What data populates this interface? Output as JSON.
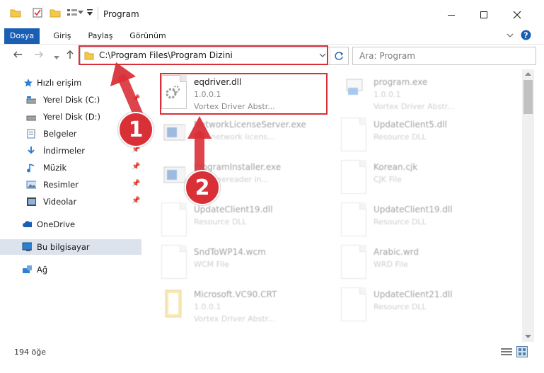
{
  "window": {
    "title": "Program"
  },
  "ribbon": {
    "tabs": [
      {
        "label": "Dosya",
        "active": true
      },
      {
        "label": "Giriş"
      },
      {
        "label": "Paylaş"
      },
      {
        "label": "Görünüm"
      }
    ]
  },
  "address": {
    "path": "C:\\Program Files\\Program Dizini"
  },
  "search": {
    "placeholder": "Ara: Program"
  },
  "nav": {
    "items": [
      {
        "label": "Hızlı erişim",
        "icon": "star-icon"
      },
      {
        "label": "Yerel Disk (C:)",
        "icon": "drive-icon",
        "pinned": true
      },
      {
        "label": "Yerel Disk (D:)",
        "icon": "drive-icon"
      },
      {
        "label": "Belgeler",
        "icon": "documents-icon"
      },
      {
        "label": "İndirmeler",
        "icon": "download-icon",
        "pinned": true
      },
      {
        "label": "Müzik",
        "icon": "music-icon",
        "pinned": true
      },
      {
        "label": "Resimler",
        "icon": "pictures-icon",
        "pinned": true
      },
      {
        "label": "Videolar",
        "icon": "videos-icon",
        "pinned": true
      },
      {
        "label": "OneDrive",
        "icon": "cloud-icon"
      },
      {
        "label": "Bu bilgisayar",
        "icon": "computer-icon",
        "selected": true
      },
      {
        "label": "Ağ",
        "icon": "network-icon"
      }
    ]
  },
  "files": [
    {
      "name": "eqdriver.dll",
      "line1": "1.0.0.1",
      "line2": "Vortex Driver Abstr...",
      "icon": "dll-icon"
    },
    {
      "name": "program.exe",
      "line1": "1.0.0.1",
      "line2": "Vortex Driver Abstr...",
      "icon": "exe-icon"
    },
    {
      "name": "NetworkLicenseServer.exe",
      "line1": "EBY network licens...",
      "line2": "",
      "icon": "exe-icon"
    },
    {
      "name": "UpdateClient5.dll",
      "line1": "Resource DLL",
      "line2": "",
      "icon": "dll-icon"
    },
    {
      "name": "ProgramInstaller.exe",
      "line1": "EBY freereader in...",
      "line2": "",
      "icon": "exe-icon"
    },
    {
      "name": "Korean.cjk",
      "line1": "CJK File",
      "line2": "",
      "icon": "file-icon"
    },
    {
      "name": "UpdateClient19.dll",
      "line1": "Resource DLL",
      "line2": "",
      "icon": "dll-icon"
    },
    {
      "name": "UpdateClient19.dll",
      "line1": "Resource DLL",
      "line2": "",
      "icon": "dll-icon"
    },
    {
      "name": "SndToWP14.wcm",
      "line1": "WCM File",
      "line2": "",
      "icon": "file-icon"
    },
    {
      "name": "Arabic.wrd",
      "line1": "WRD File",
      "line2": "",
      "icon": "file-icon"
    },
    {
      "name": "Microsoft.VC90.CRT",
      "line1": "1.0.0.1",
      "line2": "Vortex Driver Abstr...",
      "icon": "folder-icon"
    },
    {
      "name": "UpdateClient21.dll",
      "line1": "Resource DLL",
      "line2": "",
      "icon": "dll-icon"
    }
  ],
  "status": {
    "count": "194 öğe"
  },
  "annotations": {
    "badge1": "1",
    "badge2": "2"
  },
  "colors": {
    "accent": "#1a5fb4",
    "highlight": "#d93038"
  }
}
